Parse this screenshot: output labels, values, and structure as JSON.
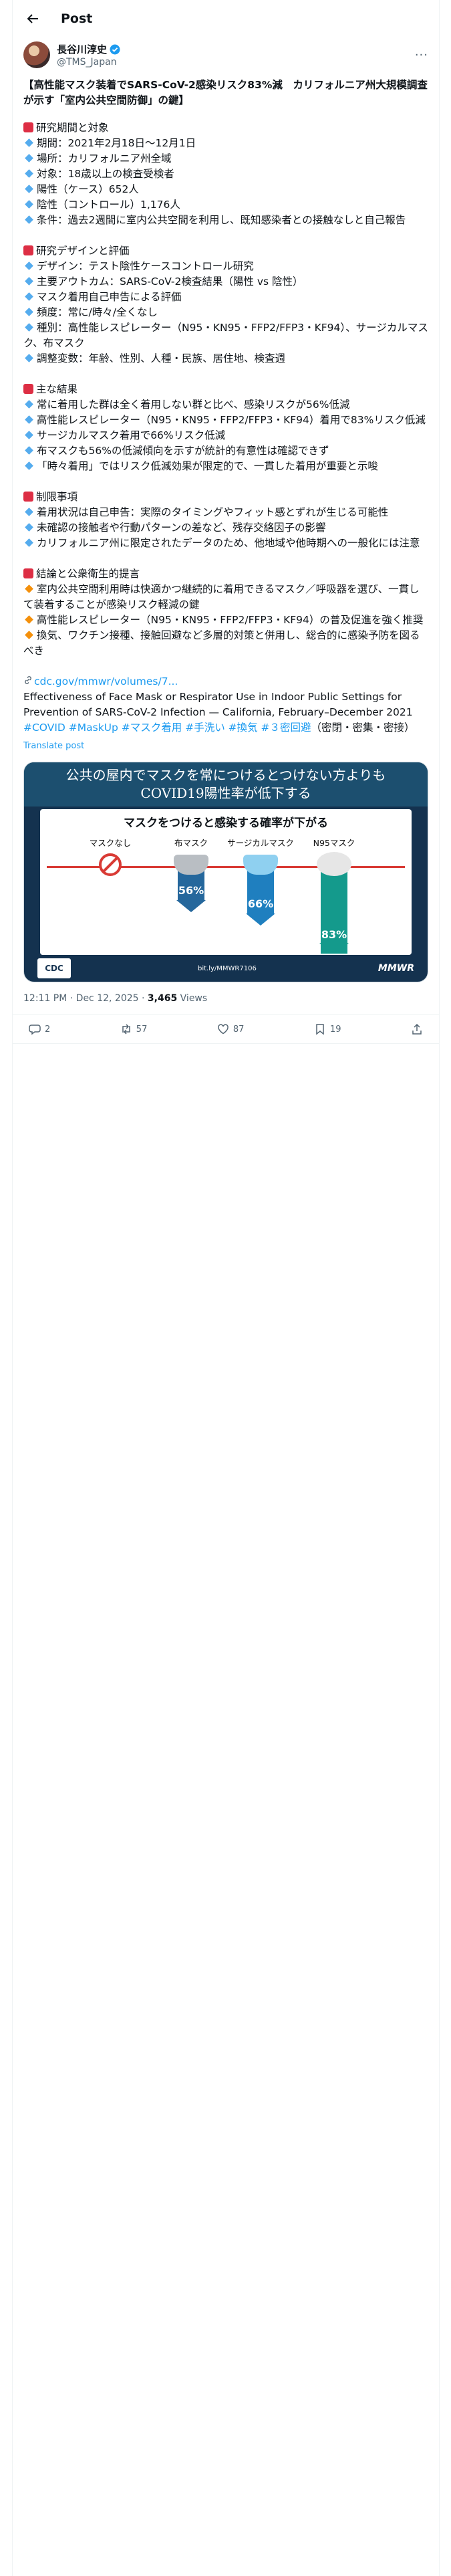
{
  "topbar": {
    "title": "Post"
  },
  "author": {
    "name": "長谷川淳史",
    "handle": "@TMS_Japan"
  },
  "tweet": {
    "headline": "【高性能マスク装着でSARS-CoV-2感染リスク83%減　カリフォルニア州大規模調査が示す「室内公共空間防御」の鍵】",
    "sections": [
      {
        "title": "研究期間と対象",
        "items": [
          "期間：2021年2月18日〜12月1日",
          "場所：カリフォルニア州全域",
          "対象：18歳以上の検査受検者",
          "陽性（ケース）652人",
          "陰性（コントロール）1,176人",
          "条件：過去2週間に室内公共空間を利用し、既知感染者との接触なしと自己報告"
        ],
        "bullet": "blue"
      },
      {
        "title": "研究デザインと評価",
        "items": [
          "デザイン：テスト陰性ケースコントロール研究",
          "主要アウトカム：SARS-CoV-2検査結果（陽性 vs 陰性）",
          "マスク着用自己申告による評価",
          "頻度：常に/時々/全くなし",
          "種別：高性能レスピレーター（N95・KN95・FFP2/FFP3・KF94）、サージカルマスク、布マスク",
          "調整変数：年齢、性別、人種・民族、居住地、検査週"
        ],
        "bullet": "blue"
      },
      {
        "title": "主な結果",
        "items": [
          "常に着用した群は全く着用しない群と比べ、感染リスクが56%低減",
          "高性能レスピレーター（N95・KN95・FFP2/FFP3・KF94）着用で83%リスク低減",
          "サージカルマスク着用で66%リスク低減",
          "布マスクも56%の低減傾向を示すが統計的有意性は確認できず",
          "「時々着用」ではリスク低減効果が限定的で、一貫した着用が重要と示唆"
        ],
        "bullet": "blue"
      },
      {
        "title": "制限事項",
        "items": [
          "着用状況は自己申告：実際のタイミングやフィット感とずれが生じる可能性",
          "未確認の接触者や行動パターンの差など、残存交絡因子の影響",
          "カリフォルニア州に限定されたデータのため、他地域や他時期への一般化には注意"
        ],
        "bullet": "blue"
      },
      {
        "title": "結論と公衆衛生的提言",
        "items": [
          "室内公共空間利用時は快適かつ継続的に着用できるマスク／呼吸器を選び、一貫して装着することが感染リスク軽減の鍵",
          "高性能レスピレーター（N95・KN95・FFP2/FFP3・KF94）の普及促進を強く推奨",
          "換気、ワクチン接種、接触回避など多層的対策と併用し、総合的に感染予防を図るべき"
        ],
        "bullet": "orange"
      }
    ],
    "link": "cdc.gov/mmwr/volumes/7...",
    "reference": "Effectiveness of Face Mask or Respirator Use in Indoor Public Settings for Prevention of SARS-CoV-2 Infection — California, February–December 2021",
    "hashtags": "#COVID #MaskUp #マスク着用 #手洗い #換気 #３密回避",
    "hashtag_tail": "（密閉・密集・密接）",
    "translate": "Translate post"
  },
  "card": {
    "headline_line1": "公共の屋内でマスクを常につけるとつけない方よりも",
    "headline_line2": "COVID19陽性率が低下する",
    "panel_title": "マスクをつけると感染する確率が下がる",
    "categories": [
      "マスクなし",
      "布マスク",
      "サージカルマスク",
      "N95マスク"
    ],
    "pct_cloth": "56%",
    "pct_surgical": "66%",
    "pct_n95": "83%",
    "logo": "CDC",
    "link": "bit.ly/MMWR7106",
    "brand": "MMWR"
  },
  "meta": {
    "time": "12:11 PM · Dec 12, 2025 · ",
    "views_count": "3,465",
    "views_label": " Views"
  },
  "actions": {
    "replies": "2",
    "reposts": "57",
    "likes": "87",
    "bookmarks": "19"
  },
  "colors": {
    "accent": "#1d9bf0",
    "red_marker": "#dd2e44",
    "blue_diamond": "#55acee",
    "orange_diamond": "#f4900c"
  }
}
